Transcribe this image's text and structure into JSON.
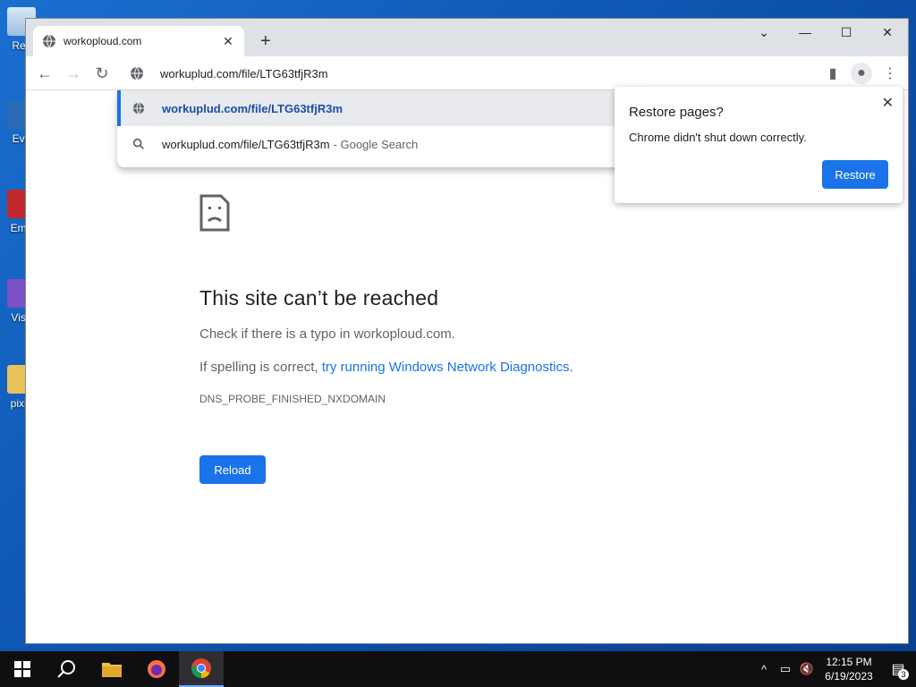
{
  "desktop": {
    "icons": [
      {
        "label": "Rec"
      },
      {
        "label": "Eve"
      },
      {
        "label": "Emb"
      },
      {
        "label": "Visu"
      },
      {
        "label": "pixie"
      }
    ]
  },
  "browser": {
    "tab": {
      "title": "workoploud.com"
    },
    "omnibox": {
      "value": "workuplud.com/file/LTG63tfjR3m"
    },
    "suggestions": [
      {
        "text": "workuplud.com/file/LTG63tfjR3m",
        "suffix": ""
      },
      {
        "text": "workuplud.com/file/LTG63tfjR3m",
        "suffix": "- Google Search"
      }
    ]
  },
  "restore_popup": {
    "title": "Restore pages?",
    "body": "Chrome didn't shut down correctly.",
    "button": "Restore"
  },
  "error_page": {
    "heading": "This site can’t be reached",
    "line1": "Check if there is a typo in workoploud.com.",
    "line2_prefix": "If spelling is correct, ",
    "line2_link": "try running Windows Network Diagnostics",
    "line2_suffix": ".",
    "error_code": "DNS_PROBE_FINISHED_NXDOMAIN",
    "reload_button": "Reload"
  },
  "taskbar": {
    "time": "12:15 PM",
    "date": "6/19/2023",
    "notification_count": "3"
  },
  "colors": {
    "accent": "#1a73e8",
    "taskbar": "#0f0f11",
    "desktop": "#0b4fa8"
  }
}
